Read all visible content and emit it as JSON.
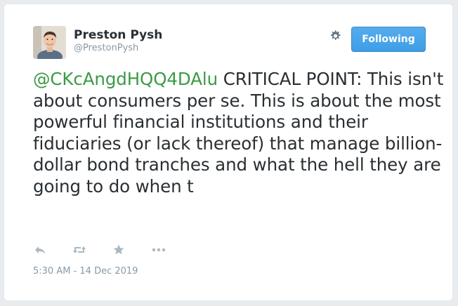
{
  "author": {
    "name": "Preston Pysh",
    "handle": "@PrestonPysh"
  },
  "follow_button": {
    "label": "Following",
    "color": "#55acee"
  },
  "tweet": {
    "mention": "@CKcAngdHQQ4DAlu",
    "body": " CRITICAL POINT: This isn't about consumers per se. This is about the most powerful financial institutions and their fiduciaries (or lack thereof) that manage billion-dollar bond tranches and what the hell they are going to do when t",
    "mention_color": "#3a9b45"
  },
  "actions": {
    "icons": [
      "reply-icon",
      "retweet-icon",
      "favorite-icon",
      "more-icon"
    ]
  },
  "timestamp": "5:30 AM - 14 Dec 2019"
}
